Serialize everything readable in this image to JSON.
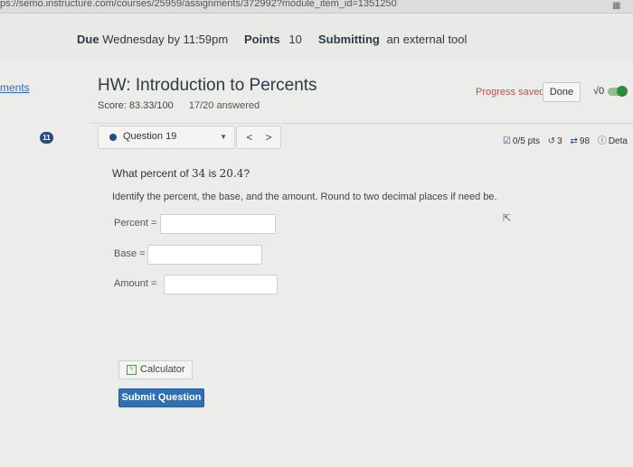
{
  "browser": {
    "url": "ps://semo.instructure.com/courses/25959/assignments/372992?module_item_id=1351250"
  },
  "due_bar": {
    "due_label": "Due",
    "due_value": "Wednesday by 11:59pm",
    "points_label": "Points",
    "points_value": "10",
    "submitting_label": "Submitting",
    "submitting_value": "an external tool"
  },
  "left_nav": {
    "modules_fragment": "ments"
  },
  "homework": {
    "title": "HW: Introduction to Percents",
    "score_text": "Score: 83.33/100",
    "answered_text": "17/20 answered",
    "progress_status": "Progress saved",
    "done_label": "Done",
    "sqrt_label": "√0",
    "question_badge": "11"
  },
  "question_nav": {
    "current_question": "Question 19",
    "prev_label": "<",
    "next_label": ">",
    "pts": "0/5 pts",
    "retries": "3",
    "attempts": "98",
    "details_label": "Deta"
  },
  "question": {
    "prompt_prefix": "What percent of ",
    "prompt_num1": "34",
    "prompt_mid": " is ",
    "prompt_num2": "20.4",
    "prompt_suffix": "?",
    "instructions": "Identify the percent, the base, and the amount. Round to two decimal places if need be."
  },
  "fields": {
    "percent_label": "Percent =",
    "base_label": "Base =",
    "amount_label": "Amount ="
  },
  "buttons": {
    "calculator": "Calculator",
    "submit": "Submit Question"
  },
  "colors": {
    "accent_blue": "#2f6fb3",
    "progress_red": "#c0504d",
    "badge_navy": "#2b4a7a"
  }
}
